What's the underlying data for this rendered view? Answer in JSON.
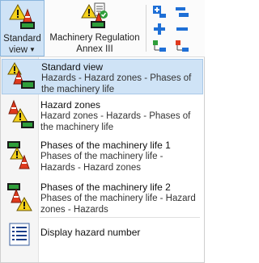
{
  "ribbon": {
    "standard_view": {
      "line1": "Standard",
      "line2": "view",
      "icon": "hazard-triangle-cone-icon"
    },
    "annex": {
      "line1": "Machinery Regulation",
      "line2": "Annex III",
      "icon": "hazard-checklist-icon"
    },
    "small_buttons": [
      "add-level-icon",
      "collapse-level-icon",
      "add-icon",
      "remove-icon",
      "indent-in-icon",
      "indent-out-icon"
    ]
  },
  "menu": {
    "items": [
      {
        "title": "Standard view",
        "description": "Hazards - Hazard zones - Phases of the machinery life",
        "selected": true
      },
      {
        "title": "Hazard zones",
        "description": "Hazard zones - Hazards - Phases of the machinery life",
        "selected": false
      },
      {
        "title": "Phases of the machinery life 1",
        "description": "Phases of the machinery life - Hazards - Hazard zones",
        "selected": false
      },
      {
        "title": "Phases of the machinery life 2",
        "description": "Phases of the machinery life - Hazard zones - Hazards",
        "selected": false
      }
    ],
    "display_hazard_number": "Display hazard number"
  },
  "colors": {
    "selected_bg": "#cfe3f6",
    "selected_border": "#a9c9e8",
    "warning_yellow": "#f5d21c",
    "cone_red": "#e03a1e",
    "plus_blue": "#1e6fd6"
  }
}
